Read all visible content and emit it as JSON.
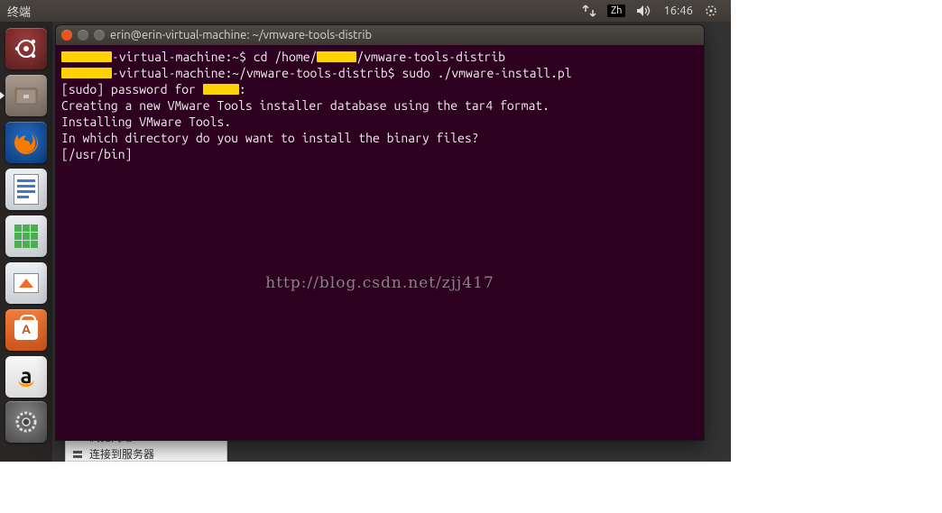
{
  "menubar": {
    "title": "终端",
    "ime": "Zh",
    "time": "16:46"
  },
  "launcher": {
    "items": [
      {
        "name": "dash-icon",
        "label": "Dash"
      },
      {
        "name": "files-icon",
        "label": "Files"
      },
      {
        "name": "firefox-icon",
        "label": "Firefox"
      },
      {
        "name": "writer-icon",
        "label": "LibreOffice Writer"
      },
      {
        "name": "calc-icon",
        "label": "LibreOffice Calc"
      },
      {
        "name": "impress-icon",
        "label": "LibreOffice Impress"
      },
      {
        "name": "software-center-icon",
        "label": "Ubuntu Software Center"
      },
      {
        "name": "amazon-icon",
        "label": "Amazon"
      },
      {
        "name": "settings-icon",
        "label": "System Settings"
      }
    ]
  },
  "terminal": {
    "window_title": "erin@erin-virtual-machine: ~/vmware-tools-distrib",
    "lines": {
      "l1_host": "-virtual-machine:~$ ",
      "l1_cmd": "cd /home/",
      "l1_tail": "/vmware-tools-distrib",
      "l2_host": "-virtual-machine:~/vmware-tools-distrib$ ",
      "l2_cmd": "sudo ./vmware-install.pl",
      "l3_pre": "[sudo] password for ",
      "l3_post": ":",
      "l4": "Creating a new VMware Tools installer database using the tar4 format.",
      "l5": "",
      "l6": "Installing VMware Tools.",
      "l7": "",
      "l8": "In which directory do you want to install the binary files?",
      "l9": "[/usr/bin]"
    }
  },
  "watermark": "http://blog.csdn.net/zjj417",
  "nautilus": {
    "row1": "浏览网络",
    "row2": "连接到服务器"
  }
}
